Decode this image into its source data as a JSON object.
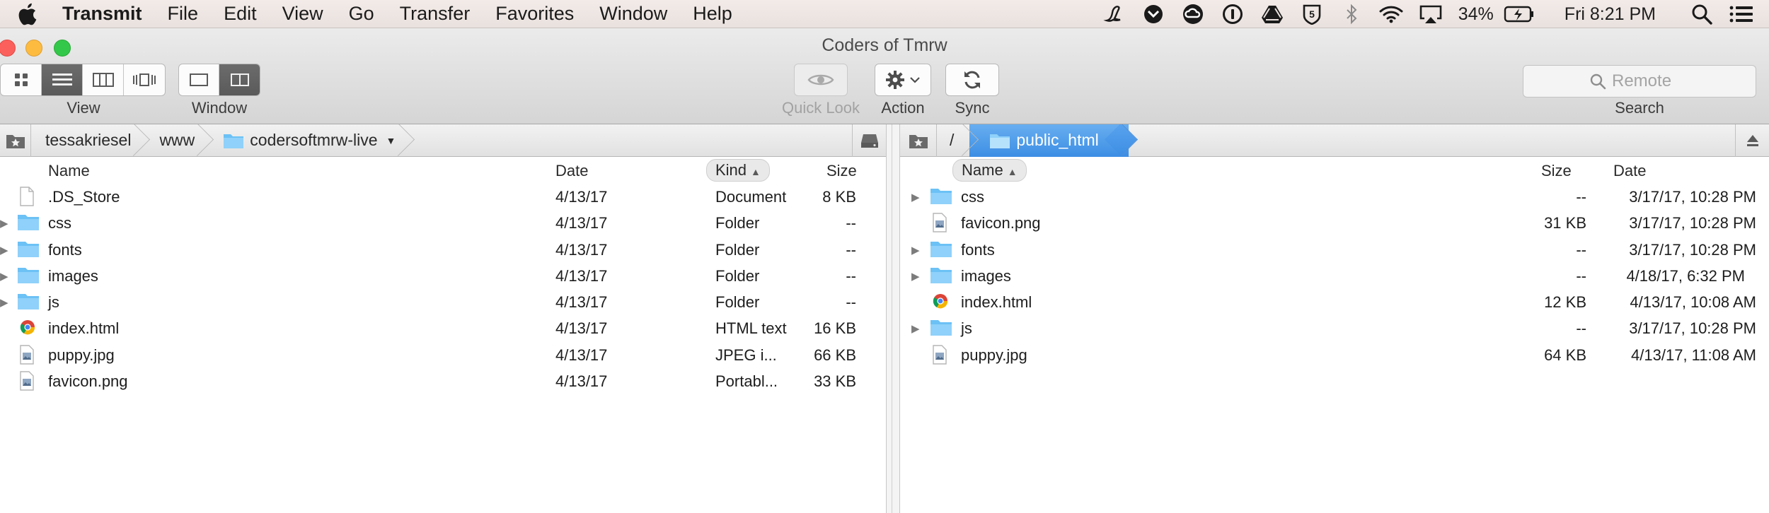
{
  "menubar": {
    "app_name": "Transmit",
    "items": [
      "File",
      "Edit",
      "View",
      "Go",
      "Transfer",
      "Favorites",
      "Window",
      "Help"
    ],
    "battery_percent": "34%",
    "clock": "Fri 8:21 PM"
  },
  "window": {
    "title": "Coders of Tmrw"
  },
  "toolbar": {
    "view_label": "View",
    "window_label": "Window",
    "quicklook_label": "Quick Look",
    "action_label": "Action",
    "sync_label": "Sync",
    "search_label": "Search",
    "search_placeholder": "Remote"
  },
  "left": {
    "path": [
      "tessakriesel",
      "www",
      "codersoftmrw-live"
    ],
    "columns": {
      "name": "Name",
      "date": "Date",
      "kind": "Kind",
      "size": "Size"
    },
    "rows": [
      {
        "name": ".DS_Store",
        "date": "4/13/17",
        "kind": "Document",
        "size": "8 KB",
        "icon": "document-icon",
        "expandable": false
      },
      {
        "name": "css",
        "date": "4/13/17",
        "kind": "Folder",
        "size": "--",
        "icon": "folder-icon",
        "expandable": true
      },
      {
        "name": "fonts",
        "date": "4/13/17",
        "kind": "Folder",
        "size": "--",
        "icon": "folder-icon",
        "expandable": true
      },
      {
        "name": "images",
        "date": "4/13/17",
        "kind": "Folder",
        "size": "--",
        "icon": "folder-icon",
        "expandable": true
      },
      {
        "name": "js",
        "date": "4/13/17",
        "kind": "Folder",
        "size": "--",
        "icon": "folder-icon",
        "expandable": true
      },
      {
        "name": "index.html",
        "date": "4/13/17",
        "kind": "HTML text",
        "size": "16 KB",
        "icon": "chrome-icon",
        "expandable": false
      },
      {
        "name": "puppy.jpg",
        "date": "4/13/17",
        "kind": "JPEG i...",
        "size": "66 KB",
        "icon": "image-file-icon",
        "expandable": false
      },
      {
        "name": "favicon.png",
        "date": "4/13/17",
        "kind": "Portabl...",
        "size": "33 KB",
        "icon": "image-file-icon",
        "expandable": false
      }
    ]
  },
  "right": {
    "path_root": "/",
    "path_current": "public_html",
    "columns": {
      "name": "Name",
      "size": "Size",
      "date": "Date"
    },
    "rows": [
      {
        "name": "css",
        "size": "--",
        "date": "3/17/17, 10:28 PM",
        "icon": "folder-icon",
        "expandable": true
      },
      {
        "name": "favicon.png",
        "size": "31 KB",
        "date": "3/17/17, 10:28 PM",
        "icon": "image-file-icon",
        "expandable": false
      },
      {
        "name": "fonts",
        "size": "--",
        "date": "3/17/17, 10:28 PM",
        "icon": "folder-icon",
        "expandable": true
      },
      {
        "name": "images",
        "size": "--",
        "date": "4/18/17, 6:32 PM",
        "icon": "folder-icon",
        "expandable": true
      },
      {
        "name": "index.html",
        "size": "12 KB",
        "date": "4/13/17, 10:08 AM",
        "icon": "chrome-icon",
        "expandable": false
      },
      {
        "name": "js",
        "size": "--",
        "date": "3/17/17, 10:28 PM",
        "icon": "folder-icon",
        "expandable": true
      },
      {
        "name": "puppy.jpg",
        "size": "64 KB",
        "date": "4/13/17, 11:08 AM",
        "icon": "image-file-icon",
        "expandable": false
      }
    ]
  },
  "colors": {
    "folder": "#6cc1f5",
    "selection": "#3c8ee4",
    "active_segment": "#5f5f5f"
  }
}
